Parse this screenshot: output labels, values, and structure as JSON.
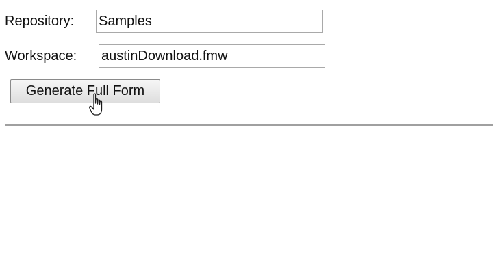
{
  "form": {
    "repository_label": "Repository:",
    "repository_value": "Samples",
    "workspace_label": "Workspace:",
    "workspace_value": "austinDownload.fmw",
    "generate_button_label": "Generate Full Form"
  },
  "cursor": {
    "type": "hand-pointer-icon"
  }
}
